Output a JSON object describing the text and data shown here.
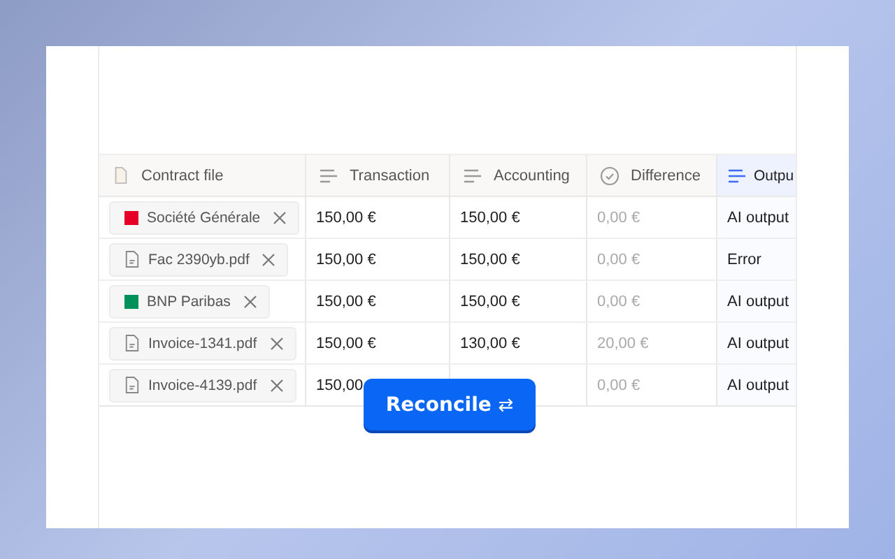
{
  "table": {
    "columns": [
      {
        "label": "Contract file",
        "kind": "file",
        "selected": false
      },
      {
        "label": "Transaction",
        "kind": "lines",
        "selected": false
      },
      {
        "label": "Accounting",
        "kind": "lines",
        "selected": false
      },
      {
        "label": "Difference",
        "kind": "check",
        "selected": false
      },
      {
        "label": "Outpu",
        "kind": "lines",
        "selected": true
      }
    ],
    "rows": [
      {
        "file": {
          "kind": "bank",
          "name": "Société Générale",
          "color": "#e60028"
        },
        "transaction": "150,00 €",
        "accounting": "150,00 €",
        "difference": "0,00 €",
        "output": "AI output"
      },
      {
        "file": {
          "kind": "file",
          "name": "Fac 2390yb.pdf"
        },
        "transaction": "150,00 €",
        "accounting": "150,00 €",
        "difference": "0,00 €",
        "output": "Error"
      },
      {
        "file": {
          "kind": "bank",
          "name": "BNP Paribas",
          "color": "#00915a"
        },
        "transaction": "150,00 €",
        "accounting": "150,00 €",
        "difference": "0,00 €",
        "output": "AI output"
      },
      {
        "file": {
          "kind": "file",
          "name": "Invoice-1341.pdf"
        },
        "transaction": "150,00 €",
        "accounting": "130,00 €",
        "difference": "20,00 €",
        "output": "AI output"
      },
      {
        "file": {
          "kind": "file",
          "name": "Invoice-4139.pdf"
        },
        "transaction": "150,00",
        "difference": "0,00 €",
        "output": "AI output"
      }
    ]
  },
  "reconcile_button": {
    "label": "Reconcile",
    "icon": "⇄"
  }
}
